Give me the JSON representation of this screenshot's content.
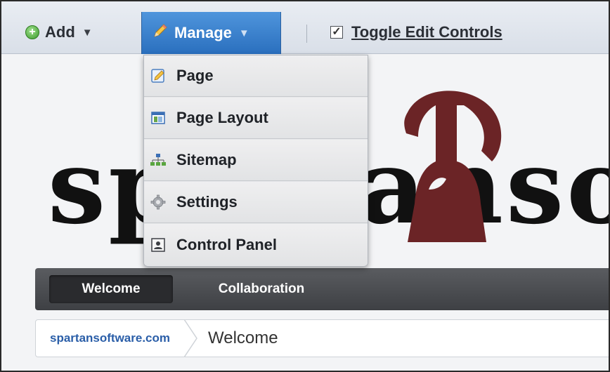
{
  "dockbar": {
    "add_label": "Add",
    "add_icon": "plus-circle-icon",
    "manage_label": "Manage",
    "manage_icon": "pencil-icon",
    "toggle_label": "Toggle Edit Controls",
    "toggle_icon": "checkbox-checked-icon",
    "caret_glyph": "▼",
    "plus_glyph": "+",
    "check_glyph": "✓",
    "accent_color": "#2f73c3"
  },
  "manage_menu": {
    "items": [
      {
        "label": "Page",
        "icon": "page-edit-icon"
      },
      {
        "label": "Page Layout",
        "icon": "layout-icon"
      },
      {
        "label": "Sitemap",
        "icon": "sitemap-icon"
      },
      {
        "label": "Settings",
        "icon": "gear-icon"
      },
      {
        "label": "Control Panel",
        "icon": "control-panel-icon"
      }
    ]
  },
  "logo": {
    "text": "spartansoft",
    "helmet_color": "#6b2426"
  },
  "nav": {
    "tabs": [
      {
        "label": "Welcome",
        "active": true
      },
      {
        "label": "Collaboration",
        "active": false
      }
    ]
  },
  "breadcrumb": {
    "site": "spartansoftware.com",
    "current": "Welcome"
  }
}
